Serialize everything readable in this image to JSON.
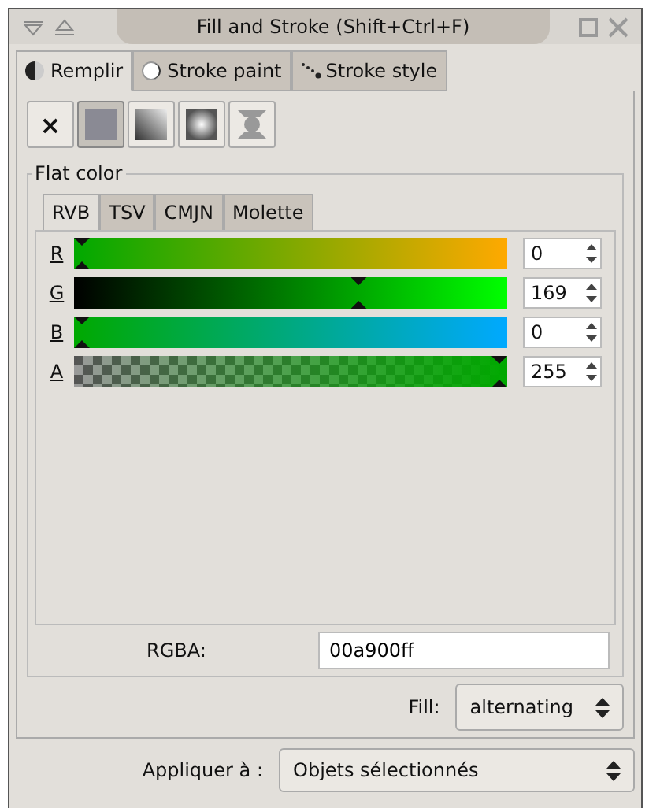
{
  "window": {
    "title": "Fill and Stroke (Shift+Ctrl+F)"
  },
  "tabs": [
    {
      "label": "Remplir",
      "kind": "fill",
      "selected": true
    },
    {
      "label": "Stroke paint",
      "kind": "stroke",
      "selected": false
    },
    {
      "label": "Stroke style",
      "kind": "style",
      "selected": false
    }
  ],
  "paint_buttons": [
    {
      "kind": "none",
      "label": "×",
      "selected": false
    },
    {
      "kind": "flat",
      "selected": true
    },
    {
      "kind": "linear",
      "selected": false
    },
    {
      "kind": "radial",
      "selected": false
    },
    {
      "kind": "mesh",
      "selected": false
    }
  ],
  "flat_color": {
    "title": "Flat color",
    "tabs": [
      {
        "label": "RVB",
        "selected": true
      },
      {
        "label": "TSV",
        "selected": false
      },
      {
        "label": "CMJN",
        "selected": false
      },
      {
        "label": "Molette",
        "selected": false
      }
    ],
    "channels": [
      {
        "name": "R",
        "kind": "r",
        "level": 0,
        "value": "0"
      },
      {
        "name": "G",
        "kind": "g",
        "level": 0.663,
        "value": "169"
      },
      {
        "name": "B",
        "kind": "b",
        "level": 0,
        "value": "0"
      },
      {
        "name": "A",
        "kind": "a",
        "level": 1,
        "value": "255"
      }
    ],
    "rgba": {
      "label": "RGBA:",
      "value": "00a900ff"
    }
  },
  "fill_rule": {
    "label": "Fill:",
    "value": "alternating"
  },
  "apply_to": {
    "label": "Appliquer à :",
    "value": "Objets sélectionnés"
  }
}
